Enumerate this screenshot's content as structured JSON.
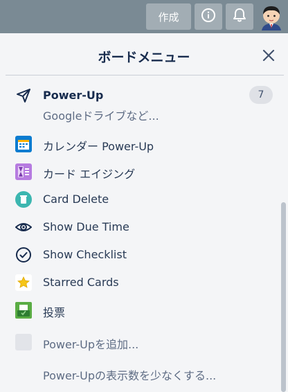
{
  "topbar": {
    "create_label": "作成",
    "info_icon": "info-icon",
    "bell_icon": "bell-icon",
    "avatar_icon": "avatar-icon",
    "background": "#7a8a94"
  },
  "menu": {
    "title": "ボードメニュー",
    "close_icon": "close-icon",
    "powerup": {
      "title": "Power-Up",
      "subtitle": "Googleドライブなど...",
      "count": "7",
      "icon": "rocket-icon"
    },
    "items": [
      {
        "label": "カレンダー Power-Up",
        "icon": "calendar-icon"
      },
      {
        "label": "カード エイジング",
        "icon": "hourglass-icon"
      },
      {
        "label": "Card Delete",
        "icon": "trash-icon"
      },
      {
        "label": "Show Due Time",
        "icon": "eye-icon"
      },
      {
        "label": "Show Checklist",
        "icon": "check-circle-icon"
      },
      {
        "label": "Starred Cards",
        "icon": "star-icon"
      },
      {
        "label": "投票",
        "icon": "vote-icon"
      }
    ],
    "add_label": "Power-Upを追加...",
    "show_less_label": "Power-Upの表示数を少なくする..."
  }
}
